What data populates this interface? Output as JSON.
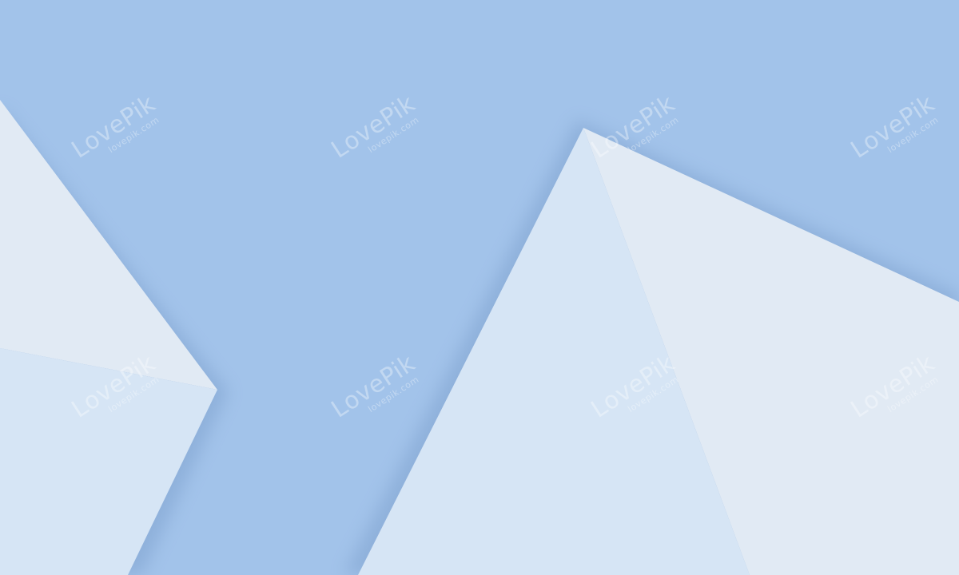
{
  "background": {
    "base_color": "#a2c3ea",
    "panel_colors": {
      "light": "#e1eaf4",
      "mid": "#d6e5f5",
      "shadow": "#6c8fbf"
    }
  },
  "watermark": {
    "brand": "LovePik",
    "site": "lovepik.com"
  }
}
